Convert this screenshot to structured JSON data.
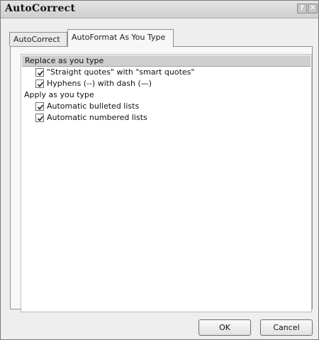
{
  "window": {
    "title": "AutoCorrect",
    "help_glyph": "?",
    "close_glyph": "✕"
  },
  "tabs": [
    {
      "label": "AutoCorrect",
      "selected": false
    },
    {
      "label": "AutoFormat As You Type",
      "selected": true
    }
  ],
  "sections": {
    "replace": {
      "label": "Replace as you type",
      "options": [
        {
          "label": "\"Straight quotes\" with \"smart quotes\"",
          "checked": true
        },
        {
          "label": "Hyphens (--) with dash (—)",
          "checked": true
        }
      ]
    },
    "apply": {
      "label": "Apply as you type",
      "options": [
        {
          "label": "Automatic bulleted lists",
          "checked": true
        },
        {
          "label": "Automatic numbered lists",
          "checked": true
        }
      ]
    }
  },
  "buttons": {
    "ok": "OK",
    "cancel": "Cancel"
  },
  "colors": {
    "section_header_bg": "#cfcfcf",
    "dialog_bg": "#eeeeee"
  }
}
